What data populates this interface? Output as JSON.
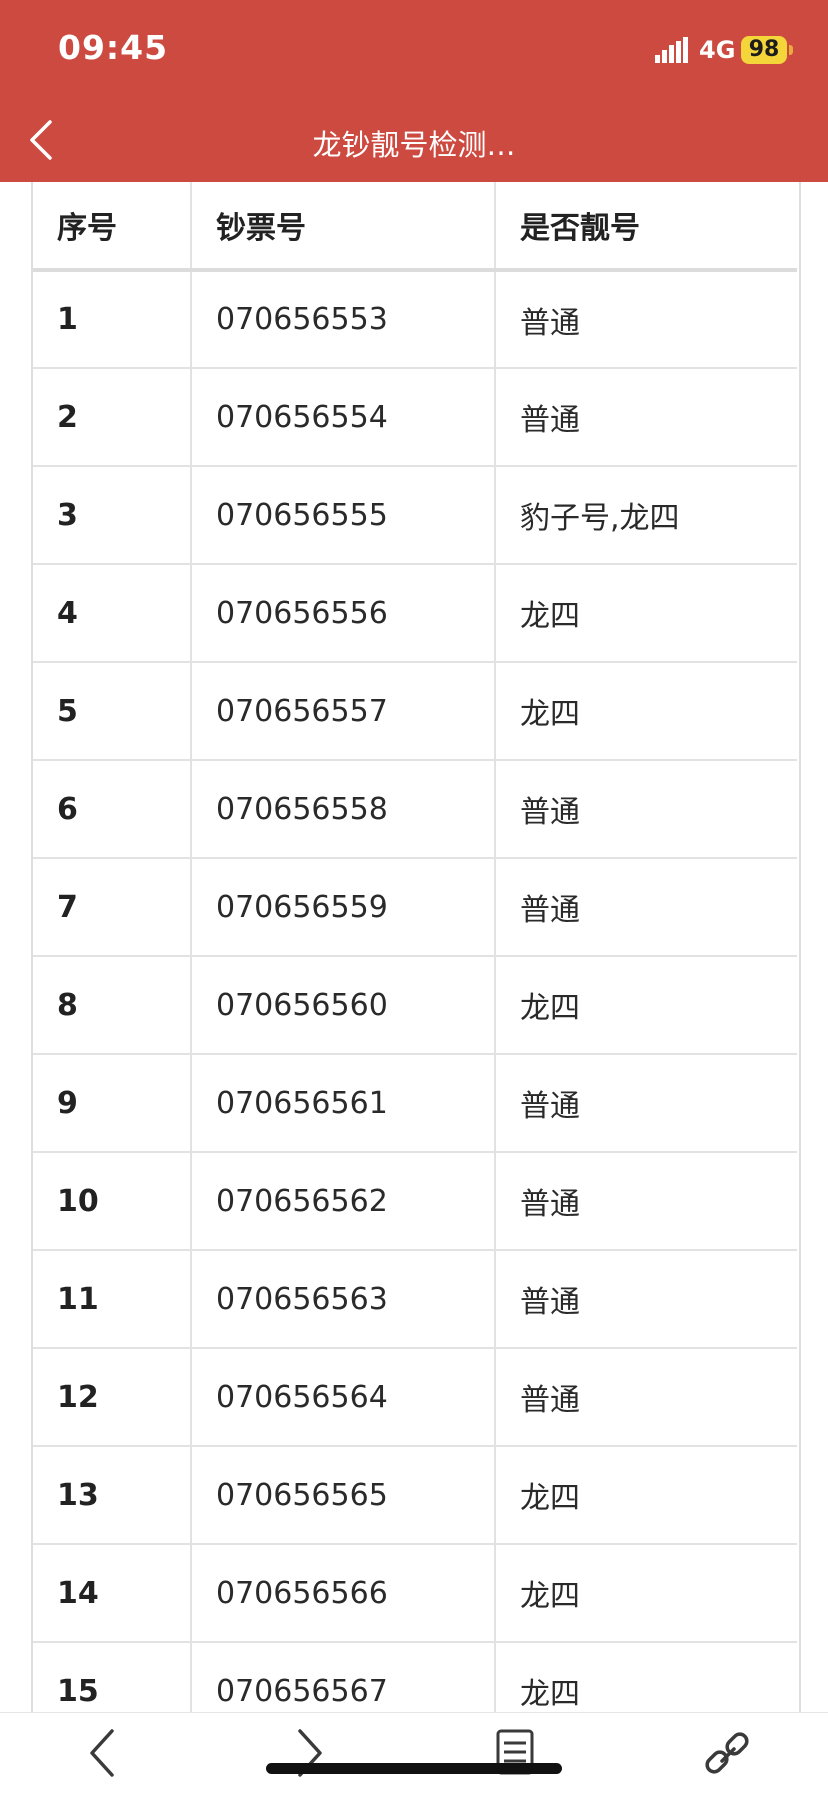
{
  "status": {
    "time": "09:45",
    "network": "4G",
    "battery": "98"
  },
  "nav": {
    "title": "龙钞靓号检测…"
  },
  "table": {
    "headers": [
      "序号",
      "钞票号",
      "是否靓号"
    ],
    "rows": [
      [
        "1",
        "070656553",
        "普通"
      ],
      [
        "2",
        "070656554",
        "普通"
      ],
      [
        "3",
        "070656555",
        "豹子号,龙四"
      ],
      [
        "4",
        "070656556",
        "龙四"
      ],
      [
        "5",
        "070656557",
        "龙四"
      ],
      [
        "6",
        "070656558",
        "普通"
      ],
      [
        "7",
        "070656559",
        "普通"
      ],
      [
        "8",
        "070656560",
        "龙四"
      ],
      [
        "9",
        "070656561",
        "普通"
      ],
      [
        "10",
        "070656562",
        "普通"
      ],
      [
        "11",
        "070656563",
        "普通"
      ],
      [
        "12",
        "070656564",
        "普通"
      ],
      [
        "13",
        "070656565",
        "龙四"
      ],
      [
        "14",
        "070656566",
        "龙四"
      ],
      [
        "15",
        "070656567",
        "龙四"
      ]
    ]
  },
  "toolbar": {
    "icons": [
      "chevron-left-icon",
      "chevron-right-icon",
      "pages-icon",
      "link-icon"
    ]
  },
  "colors": {
    "header_bg": "#cd4a40",
    "battery_badge": "#f5d63a"
  }
}
